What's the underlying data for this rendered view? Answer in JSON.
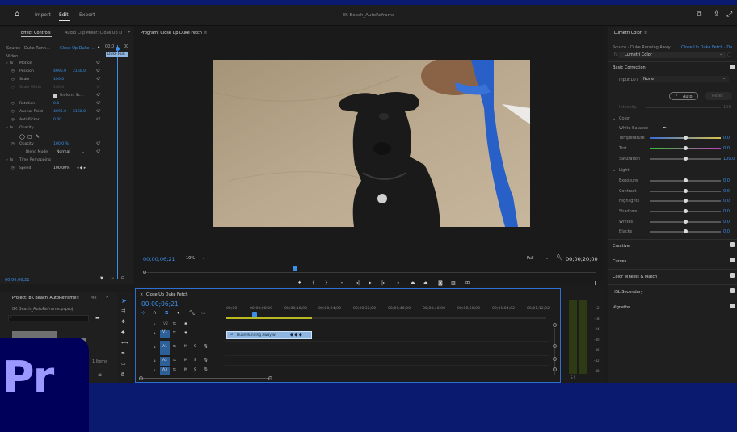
{
  "topbar": {
    "tabs": [
      {
        "label": "Import"
      },
      {
        "label": "Edit"
      },
      {
        "label": "Export"
      }
    ],
    "title": "8K Beach_AutoReframe"
  },
  "effect_controls": {
    "tab1": "Effect Controls",
    "tab2": "Audio Clip Mixer: Close Up D",
    "source": "Source · Duke Runn...",
    "seq": "Close Up Duke ...",
    "tc_start": "00;0",
    "tc_end": "00",
    "clip_label": "Duke Run",
    "video_label": "Video",
    "rows": [
      {
        "name": "Motion",
        "value": "",
        "value2": ""
      },
      {
        "name": "Position",
        "value": "4096.0",
        "value2": "2160.0"
      },
      {
        "name": "Scale",
        "value": "100.0",
        "value2": ""
      },
      {
        "name": "Scale Width",
        "value": "100.0",
        "value2": ""
      },
      {
        "name": "Uniform Sc...",
        "value": "",
        "value2": ""
      },
      {
        "name": "Rotation",
        "value": "0.0",
        "value2": ""
      },
      {
        "name": "Anchor Point",
        "value": "4096.0",
        "value2": "2160.0"
      },
      {
        "name": "Anti-flicker...",
        "value": "0.00",
        "value2": ""
      },
      {
        "name": "Opacity",
        "value": "",
        "value2": ""
      },
      {
        "name": "Opacity",
        "value": "100.0 %",
        "value2": ""
      },
      {
        "name": "Blend Mode",
        "value": "Normal",
        "value2": ""
      },
      {
        "name": "Time Remapping",
        "value": "",
        "value2": ""
      },
      {
        "name": "Speed",
        "value": "100.00%",
        "value2": ""
      }
    ],
    "bottom_tc": "00;00;06;21"
  },
  "program": {
    "title": "Program: Close Up Duke Fetch",
    "tc": "00;00;06;21",
    "zoom": "10%",
    "quality": "Full",
    "duration": "00;00;20;00"
  },
  "project": {
    "tab": "Project: 8K Beach_AutoReframe",
    "tab2": "Me",
    "file": "8K Beach_AutoReframe.prproj",
    "item_label": "1 Items"
  },
  "timeline": {
    "title": "Close Up Duke Fetch",
    "tc": "00;00;06;21",
    "ruler": [
      "00;00",
      "00;00;08;00",
      "00;00;16;00",
      "00;00;24;00",
      "00;00;32;00",
      "00;00;40;00",
      "00;00;48;00",
      "00;00;56;00",
      "00;01;04;02",
      "00;01;12;02"
    ],
    "tracks": [
      {
        "name": "V2",
        "letter": "",
        "s": ""
      },
      {
        "name": "V1",
        "letter": "",
        "s": ""
      },
      {
        "name": "A1",
        "letter": "M",
        "s": "S"
      },
      {
        "name": "A2",
        "letter": "M",
        "s": "S"
      },
      {
        "name": "A3",
        "letter": "M",
        "s": "S"
      }
    ],
    "clip_name": "Duke Running Away w"
  },
  "meters": {
    "labels": [
      "-12",
      "-18",
      "-24",
      "-30",
      "-36",
      "-42",
      "-48"
    ],
    "bottom": "S  S"
  },
  "lumetri": {
    "tab": "Lumetri Color",
    "source": "Source · Duke Running Away...",
    "seq": "Close Up Duke Fetch · Du...",
    "fx": "Lumetri Color",
    "basic": "Basic Correction",
    "input_lut": "Input LUT",
    "lut_value": "None",
    "auto": "Auto",
    "reset": "Reset",
    "intensity": "Intensity",
    "intensity_val": "100",
    "color": "Color",
    "white_balance": "White Balance",
    "sliders": [
      {
        "name": "Temperature",
        "value": "0.0",
        "level": 0.5
      },
      {
        "name": "Tint",
        "value": "0.0",
        "level": 0.5
      },
      {
        "name": "Saturation",
        "value": "100.0",
        "level": 0.5
      }
    ],
    "light": "Light",
    "light_sliders": [
      {
        "name": "Exposure",
        "value": "0.0"
      },
      {
        "name": "Contrast",
        "value": "0.0"
      },
      {
        "name": "Highlights",
        "value": "0.0"
      },
      {
        "name": "Shadows",
        "value": "0.0"
      },
      {
        "name": "Whites",
        "value": "0.0"
      },
      {
        "name": "Blacks",
        "value": "0.0"
      }
    ],
    "sections": [
      "Creative",
      "Curves",
      "Color Wheels & Match",
      "HSL Secondary",
      "Vignette"
    ]
  },
  "logo": {
    "text": "Pr"
  },
  "colors": {
    "accent": "#3b8fe8",
    "clip": "#8fb6e0",
    "bg": "#0a1a6e",
    "logo_bg": "#00005b",
    "logo_fg": "#9999ff"
  }
}
